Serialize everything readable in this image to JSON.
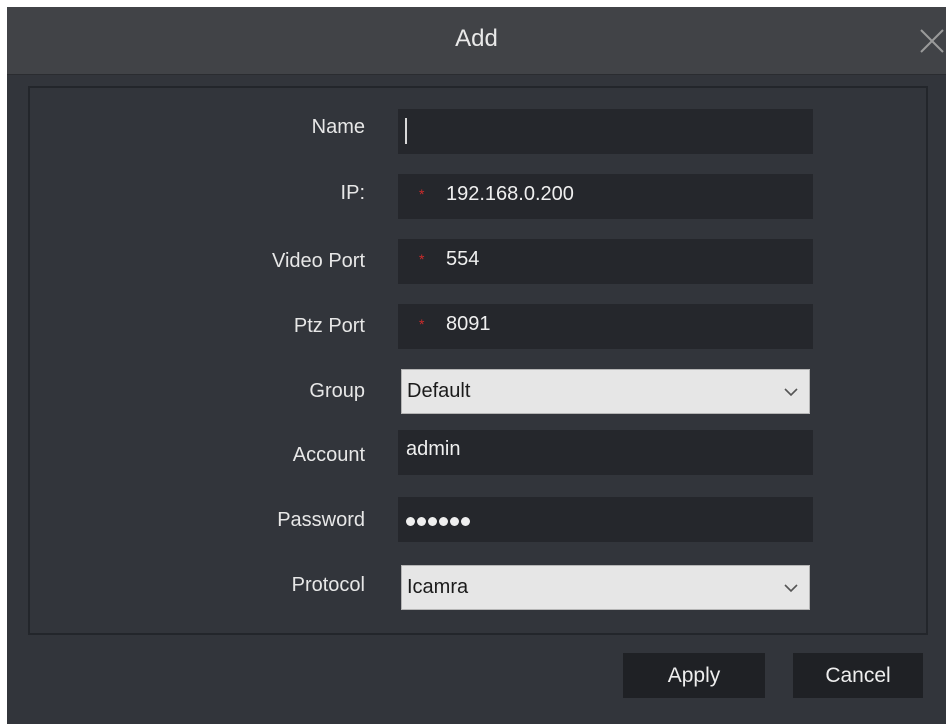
{
  "dialog": {
    "title": "Add",
    "close_icon": "close-icon"
  },
  "form": {
    "name": {
      "label": "Name",
      "value": ""
    },
    "ip": {
      "label": "IP:",
      "required_mark": "*",
      "value": "192.168.0.200"
    },
    "video_port": {
      "label": "Video Port",
      "required_mark": "*",
      "value": "554"
    },
    "ptz_port": {
      "label": "Ptz Port",
      "required_mark": "*",
      "value": "8091"
    },
    "group": {
      "label": "Group",
      "selected": "Default",
      "icon": "chevron-down-icon"
    },
    "account": {
      "label": "Account",
      "value": "admin"
    },
    "password": {
      "label": "Password",
      "masked_length": 6
    },
    "protocol": {
      "label": "Protocol",
      "selected": "Icamra",
      "icon": "chevron-down-icon"
    }
  },
  "buttons": {
    "apply_label": "Apply",
    "cancel_label": "Cancel"
  },
  "colors": {
    "required": "#cc2b2b",
    "dialog_bg": "#32353b",
    "titlebar_bg": "#414347",
    "field_bg": "#25272c"
  }
}
